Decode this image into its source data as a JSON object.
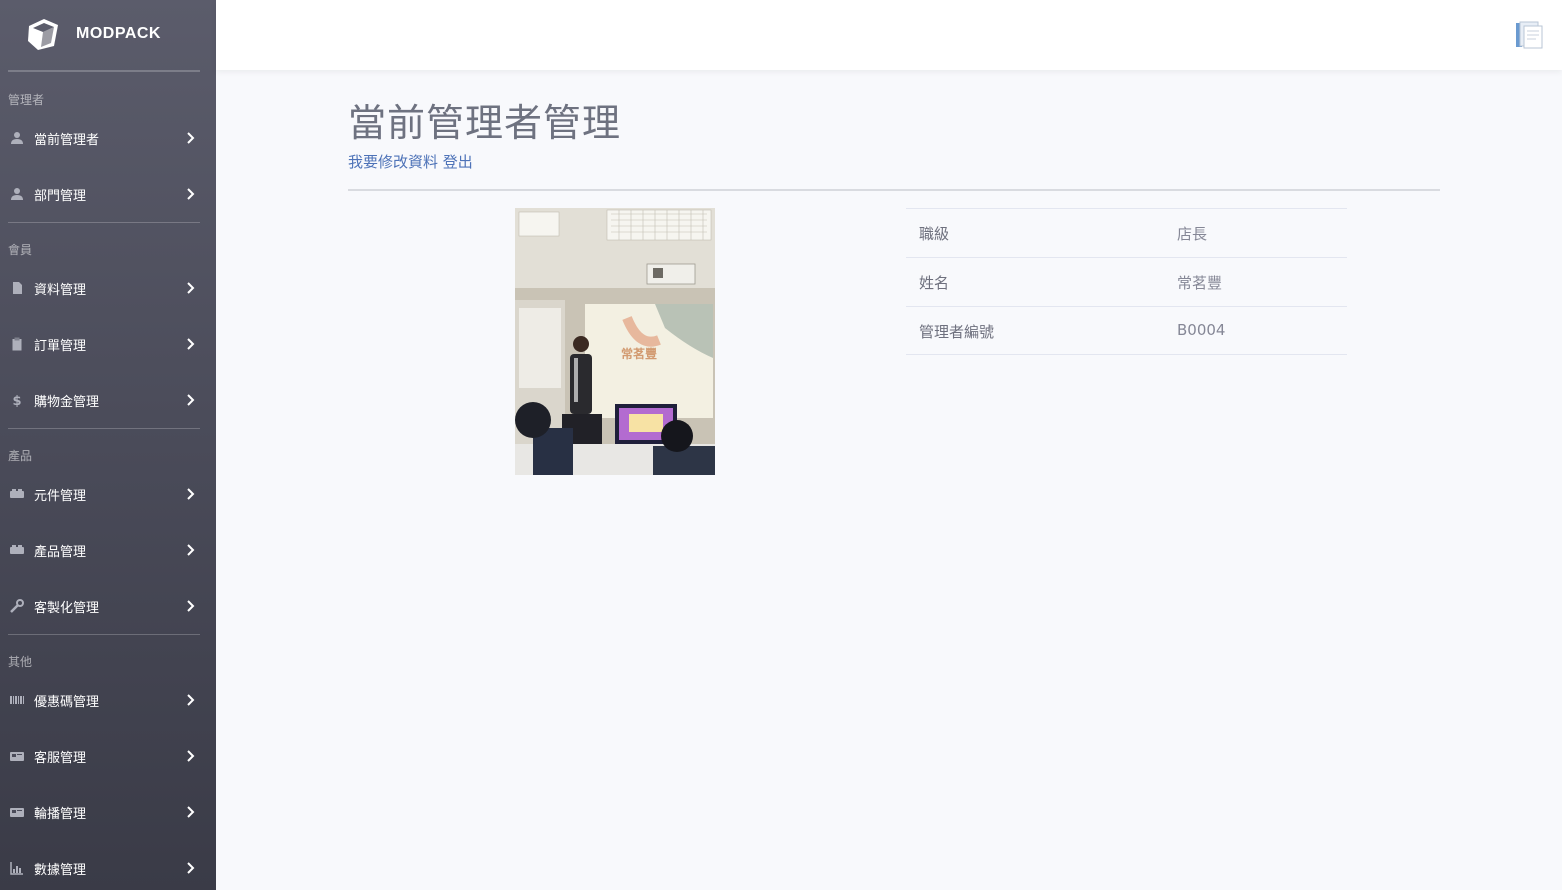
{
  "app": {
    "brand": "MODPACK"
  },
  "sidebar": {
    "sections": [
      {
        "label": "管理者"
      },
      {
        "label": "會員"
      },
      {
        "label": "產品"
      },
      {
        "label": "其他"
      }
    ],
    "items": [
      {
        "label": "當前管理者",
        "icon": "user-icon"
      },
      {
        "label": "部門管理",
        "icon": "user-icon"
      },
      {
        "label": "資料管理",
        "icon": "file-icon"
      },
      {
        "label": "訂單管理",
        "icon": "clipboard-icon"
      },
      {
        "label": "購物金管理",
        "icon": "dollar-icon"
      },
      {
        "label": "元件管理",
        "icon": "boxes-icon"
      },
      {
        "label": "產品管理",
        "icon": "boxes-icon"
      },
      {
        "label": "客製化管理",
        "icon": "wrench-icon"
      },
      {
        "label": "優惠碼管理",
        "icon": "barcode-icon"
      },
      {
        "label": "客服管理",
        "icon": "id-card-icon"
      },
      {
        "label": "輪播管理",
        "icon": "id-card-icon"
      },
      {
        "label": "數據管理",
        "icon": "chart-icon"
      }
    ]
  },
  "main": {
    "title": "當前管理者管理",
    "edit_link": "我要修改資料",
    "logout_link": "登出",
    "photo": {
      "screen_caption": "常茗豐"
    },
    "info": [
      {
        "key": "職級",
        "value": "店長"
      },
      {
        "key": "姓名",
        "value": "常茗豐"
      },
      {
        "key": "管理者編號",
        "value": "B0004"
      }
    ]
  }
}
